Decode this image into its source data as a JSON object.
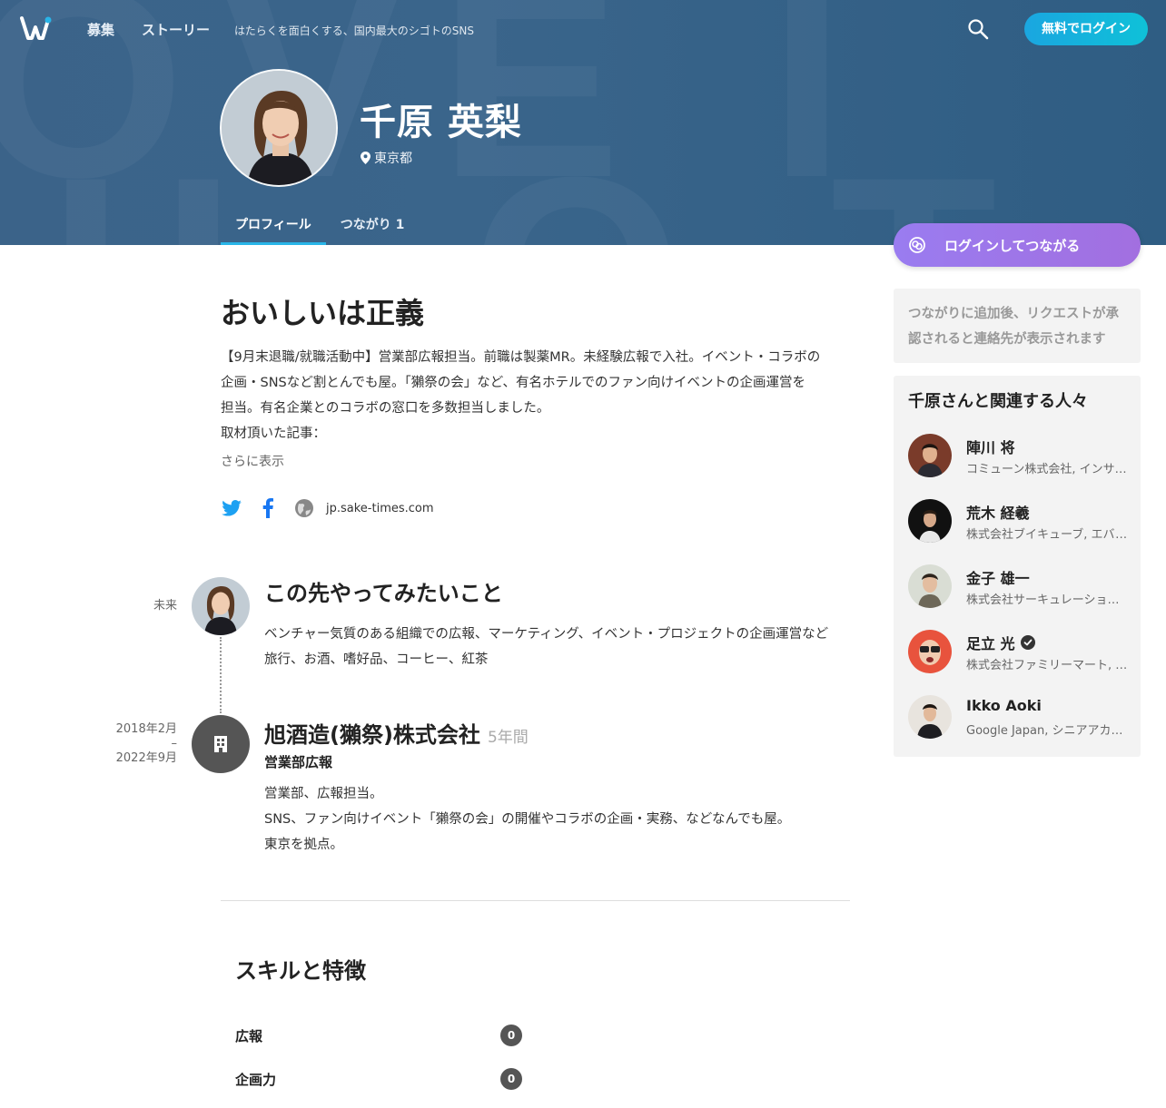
{
  "nav": {
    "recruit": "募集",
    "stories": "ストーリー",
    "tagline": "はたらくを面白くする、国内最大のシゴトのSNS",
    "login": "無料でログイン"
  },
  "profile": {
    "name": "千原 英梨",
    "location": "東京都",
    "tabs": [
      {
        "label": "プロフィール",
        "active": true
      },
      {
        "label": "つながり 1",
        "active": false
      }
    ]
  },
  "about": {
    "headline": "おいしいは正義",
    "intro_lines": [
      "【9月末退職/就職活動中】営業部広報担当。前職は製薬MR。未経験広報で入社。イベント・コラボの",
      "企画・SNSなど割とんでも屋。「獺祭の会」など、有名ホテルでのファン向けイベントの企画運営を",
      "担当。有名企業とのコラボの窓口を多数担当しました。",
      "取材頂いた記事："
    ],
    "more": "さらに表示",
    "website": "jp.sake-times.com"
  },
  "timeline": {
    "future": {
      "date": "未来",
      "title": "この先やってみたいこと",
      "lines": [
        "ベンチャー気質のある組織での広報、マーケティング、イベント・プロジェクトの企画運営など",
        "旅行、お酒、嗜好品、コーヒー、紅茶"
      ]
    },
    "job": {
      "date_start": "2018年2月",
      "date_sep": "–",
      "date_end": "2022年9月",
      "company": "旭酒造(獺祭)株式会社",
      "duration": "5年間",
      "role": "営業部広報",
      "lines": [
        "営業部、広報担当。",
        "SNS、ファン向けイベント「獺祭の会」の開催やコラボの企画・実務、などなんでも屋。",
        "東京を拠点。"
      ]
    }
  },
  "skills": {
    "title": "スキルと特徴",
    "items": [
      {
        "name": "広報",
        "count": "0"
      },
      {
        "name": "企画力",
        "count": "0"
      }
    ]
  },
  "sidebar": {
    "connect": "ログインしてつながる",
    "note": "つながりに追加後、リクエストが承認されると連絡先が表示されます",
    "related_title": "千原さんと関連する人々",
    "people": [
      {
        "name": "陣川 将",
        "sub": "コミューン株式会社, インサイドセールス",
        "verified": false
      },
      {
        "name": "荒木 経羲",
        "sub": "株式会社ブイキューブ, エバンジェリスト",
        "verified": false
      },
      {
        "name": "金子 雄一",
        "sub": "株式会社サーキュレーション, 代表取締役",
        "verified": false
      },
      {
        "name": "足立 光",
        "sub": "株式会社ファミリーマート, エグゼクティブ",
        "verified": true
      },
      {
        "name": "Ikko Aoki",
        "sub": "Google Japan, シニアアカウントマネージャー",
        "verified": false
      }
    ]
  },
  "colors": {
    "hero": "#3a658b",
    "accent_blue": "#29b5e8",
    "connect_purple": "#9a7cf0"
  }
}
